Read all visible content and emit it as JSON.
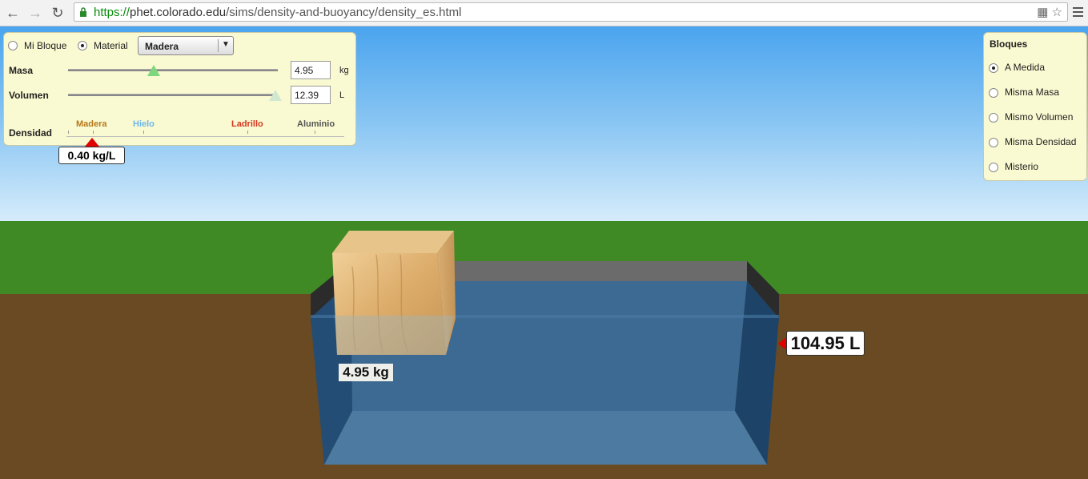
{
  "browser": {
    "url_scheme": "https://",
    "url_rest_host": "phet.colorado.edu",
    "url_path": "/sims/density-and-buoyancy/density_es.html"
  },
  "controls": {
    "mode_my_block": "Mi Bloque",
    "mode_material": "Material",
    "material_selected": "Madera",
    "mass_label": "Masa",
    "mass_value": "4.95",
    "mass_unit": "kg",
    "mass_slider_fraction": 0.41,
    "volume_label": "Volumen",
    "volume_value": "12.39",
    "volume_unit": "L",
    "volume_slider_fraction": 0.99,
    "density_label": "Densidad",
    "density_ticks": [
      {
        "label": "Madera",
        "color": "#b5781b"
      },
      {
        "label": "Hielo",
        "color": "#6cb7ec"
      },
      {
        "label": "Ladrillo",
        "color": "#d4361f"
      },
      {
        "label": "Aluminio",
        "color": "#555555"
      }
    ],
    "density_readout": "0.40 kg/L"
  },
  "blocks_panel": {
    "title": "Bloques",
    "options": [
      "A Medida",
      "Misma Masa",
      "Mismo Volumen",
      "Misma Densidad",
      "Misterio"
    ],
    "selected_index": 0
  },
  "scene": {
    "block_mass_label": "4.95 kg",
    "water_volume_label": "104.95 L",
    "colors": {
      "grass": "#3f8a24",
      "ground": "#6a4a22",
      "water": "#3b6b96"
    }
  }
}
